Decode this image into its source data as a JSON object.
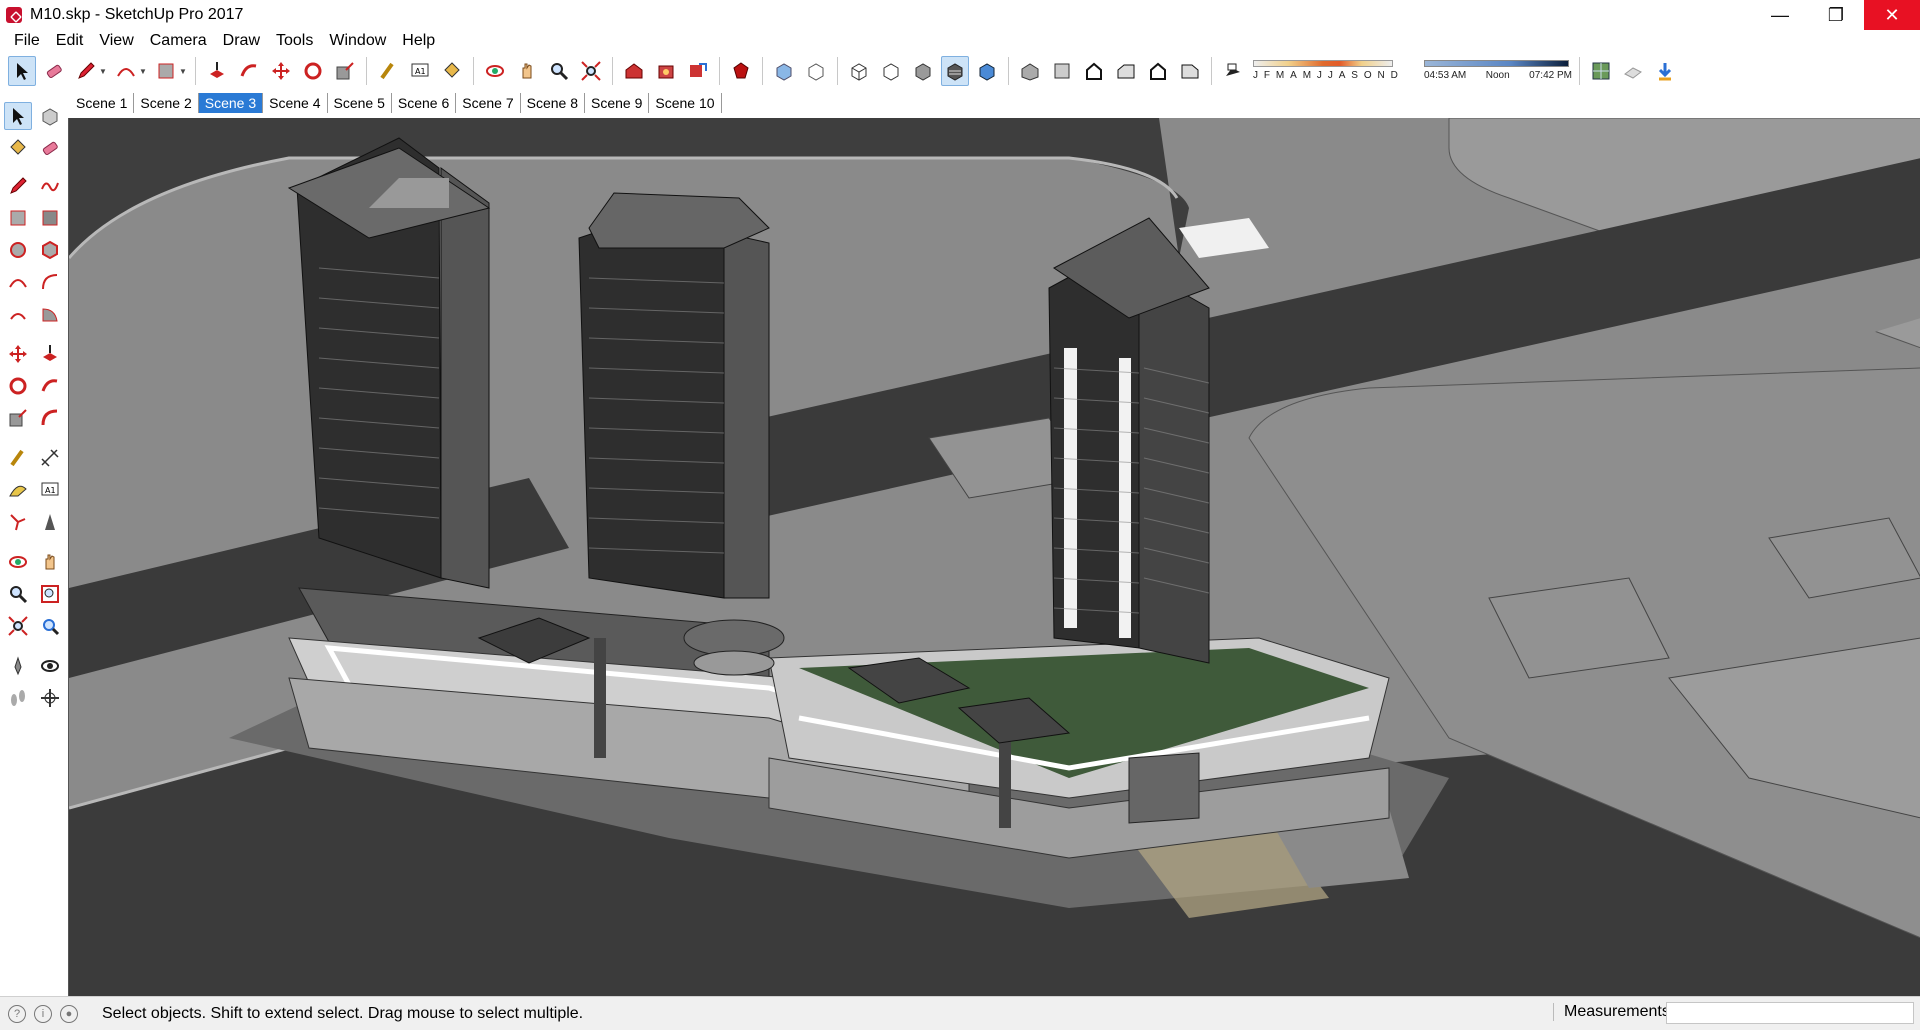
{
  "window": {
    "title": "M10.skp - SketchUp Pro 2017",
    "controls": {
      "minimize": "—",
      "restore": "❐",
      "close": "✕"
    }
  },
  "menu": [
    "File",
    "Edit",
    "View",
    "Camera",
    "Draw",
    "Tools",
    "Window",
    "Help"
  ],
  "toolbar": {
    "shadow_months": [
      "J",
      "F",
      "M",
      "A",
      "M",
      "J",
      "J",
      "A",
      "S",
      "O",
      "N",
      "D"
    ],
    "time_start": "04:53 AM",
    "time_mid": "Noon",
    "time_end": "07:42 PM"
  },
  "scenes": {
    "tabs": [
      "Scene 1",
      "Scene 2",
      "Scene 3",
      "Scene 4",
      "Scene 5",
      "Scene 6",
      "Scene 7",
      "Scene 8",
      "Scene 9",
      "Scene 10"
    ],
    "active_index": 2
  },
  "statusbar": {
    "hint": "Select objects. Shift to extend select. Drag mouse to select multiple.",
    "measurements_label": "Measurements",
    "measurements_value": ""
  },
  "colors": {
    "accent": "#2a7ad5",
    "close_button": "#e81123",
    "ground": "#8a8a8a",
    "road": "#3a3a3a",
    "building": "#4a4a4a"
  }
}
